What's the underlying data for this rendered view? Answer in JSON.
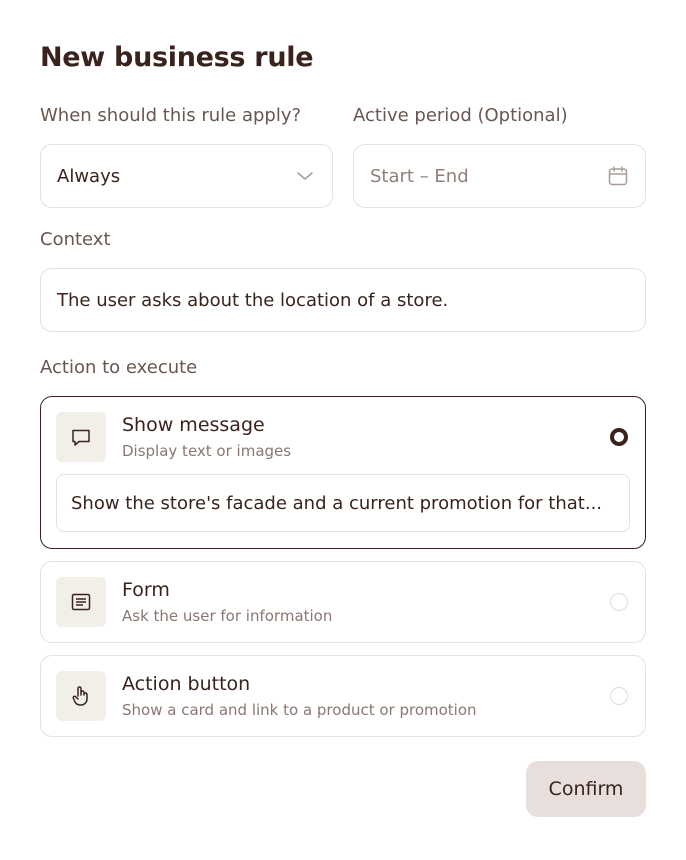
{
  "dialog": {
    "title": "New business rule"
  },
  "when": {
    "label": "When should this rule apply?",
    "value": "Always",
    "icon": "chevron-down-icon"
  },
  "period": {
    "label": "Active period (Optional)",
    "placeholder": "Start – End",
    "icon": "calendar-icon"
  },
  "context": {
    "label": "Context",
    "value": "The user asks about the location of a store."
  },
  "action": {
    "label": "Action to execute",
    "options": [
      {
        "title": "Show message",
        "description": "Display text or images",
        "icon": "message-icon",
        "selected": true,
        "input_value": "Show the store's facade and a current promotion for that..."
      },
      {
        "title": "Form",
        "description": "Ask the user for information",
        "icon": "form-icon",
        "selected": false
      },
      {
        "title": "Action button",
        "description": "Show a card and link to a product or promotion",
        "icon": "pointer-hand-icon",
        "selected": false
      }
    ]
  },
  "footer": {
    "confirm_label": "Confirm"
  },
  "colors": {
    "text": "#3a231d",
    "muted": "#6a5650",
    "border": "#e7e1dd",
    "icon_bg": "#f2efe9",
    "confirm_bg": "#e8dfdc"
  }
}
